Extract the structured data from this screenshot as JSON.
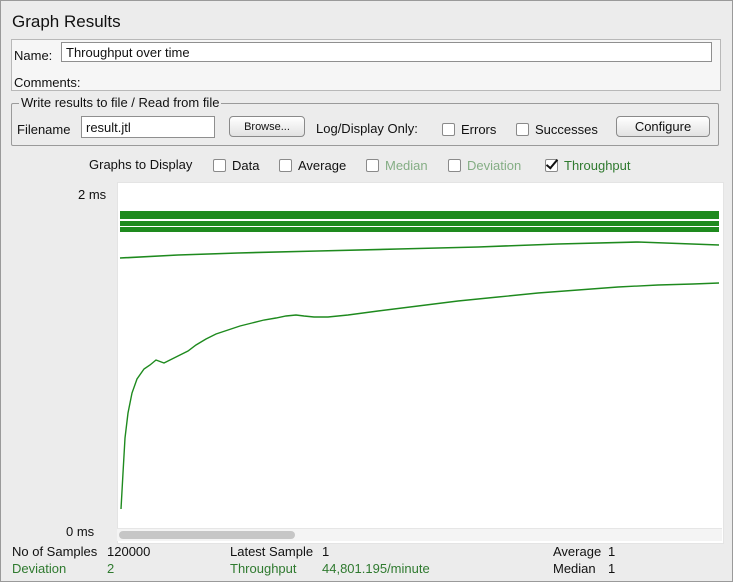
{
  "window": {
    "title": "Graph Results"
  },
  "name_panel": {
    "name_label": "Name:",
    "name_value": "Throughput over time",
    "comments_label": "Comments:"
  },
  "file_panel": {
    "legend": "Write results to file / Read from file",
    "filename_label": "Filename",
    "filename_value": "result.jtl",
    "browse_label": "Browse...",
    "log_display_label": "Log/Display Only:",
    "errors_label": "Errors",
    "successes_label": "Successes",
    "configure_label": "Configure"
  },
  "graphs": {
    "label": "Graphs to Display",
    "options": {
      "data": {
        "label": "Data",
        "checked": false
      },
      "average": {
        "label": "Average",
        "checked": false
      },
      "median": {
        "label": "Median",
        "checked": false
      },
      "deviation": {
        "label": "Deviation",
        "checked": false
      },
      "throughput": {
        "label": "Throughput",
        "checked": true
      }
    }
  },
  "chart": {
    "y_top_label": "2 ms",
    "y_bottom_label": "0 ms",
    "line_color": "#1e8a1e"
  },
  "stats": {
    "samples_label": "No of Samples",
    "samples_value": "120000",
    "latest_label": "Latest Sample",
    "latest_value": "1",
    "average_label": "Average",
    "average_value": "1",
    "deviation_label": "Deviation",
    "deviation_value": "2",
    "throughput_label": "Throughput",
    "throughput_value": "44,801.195/minute",
    "median_label": "Median",
    "median_value": "1"
  }
}
